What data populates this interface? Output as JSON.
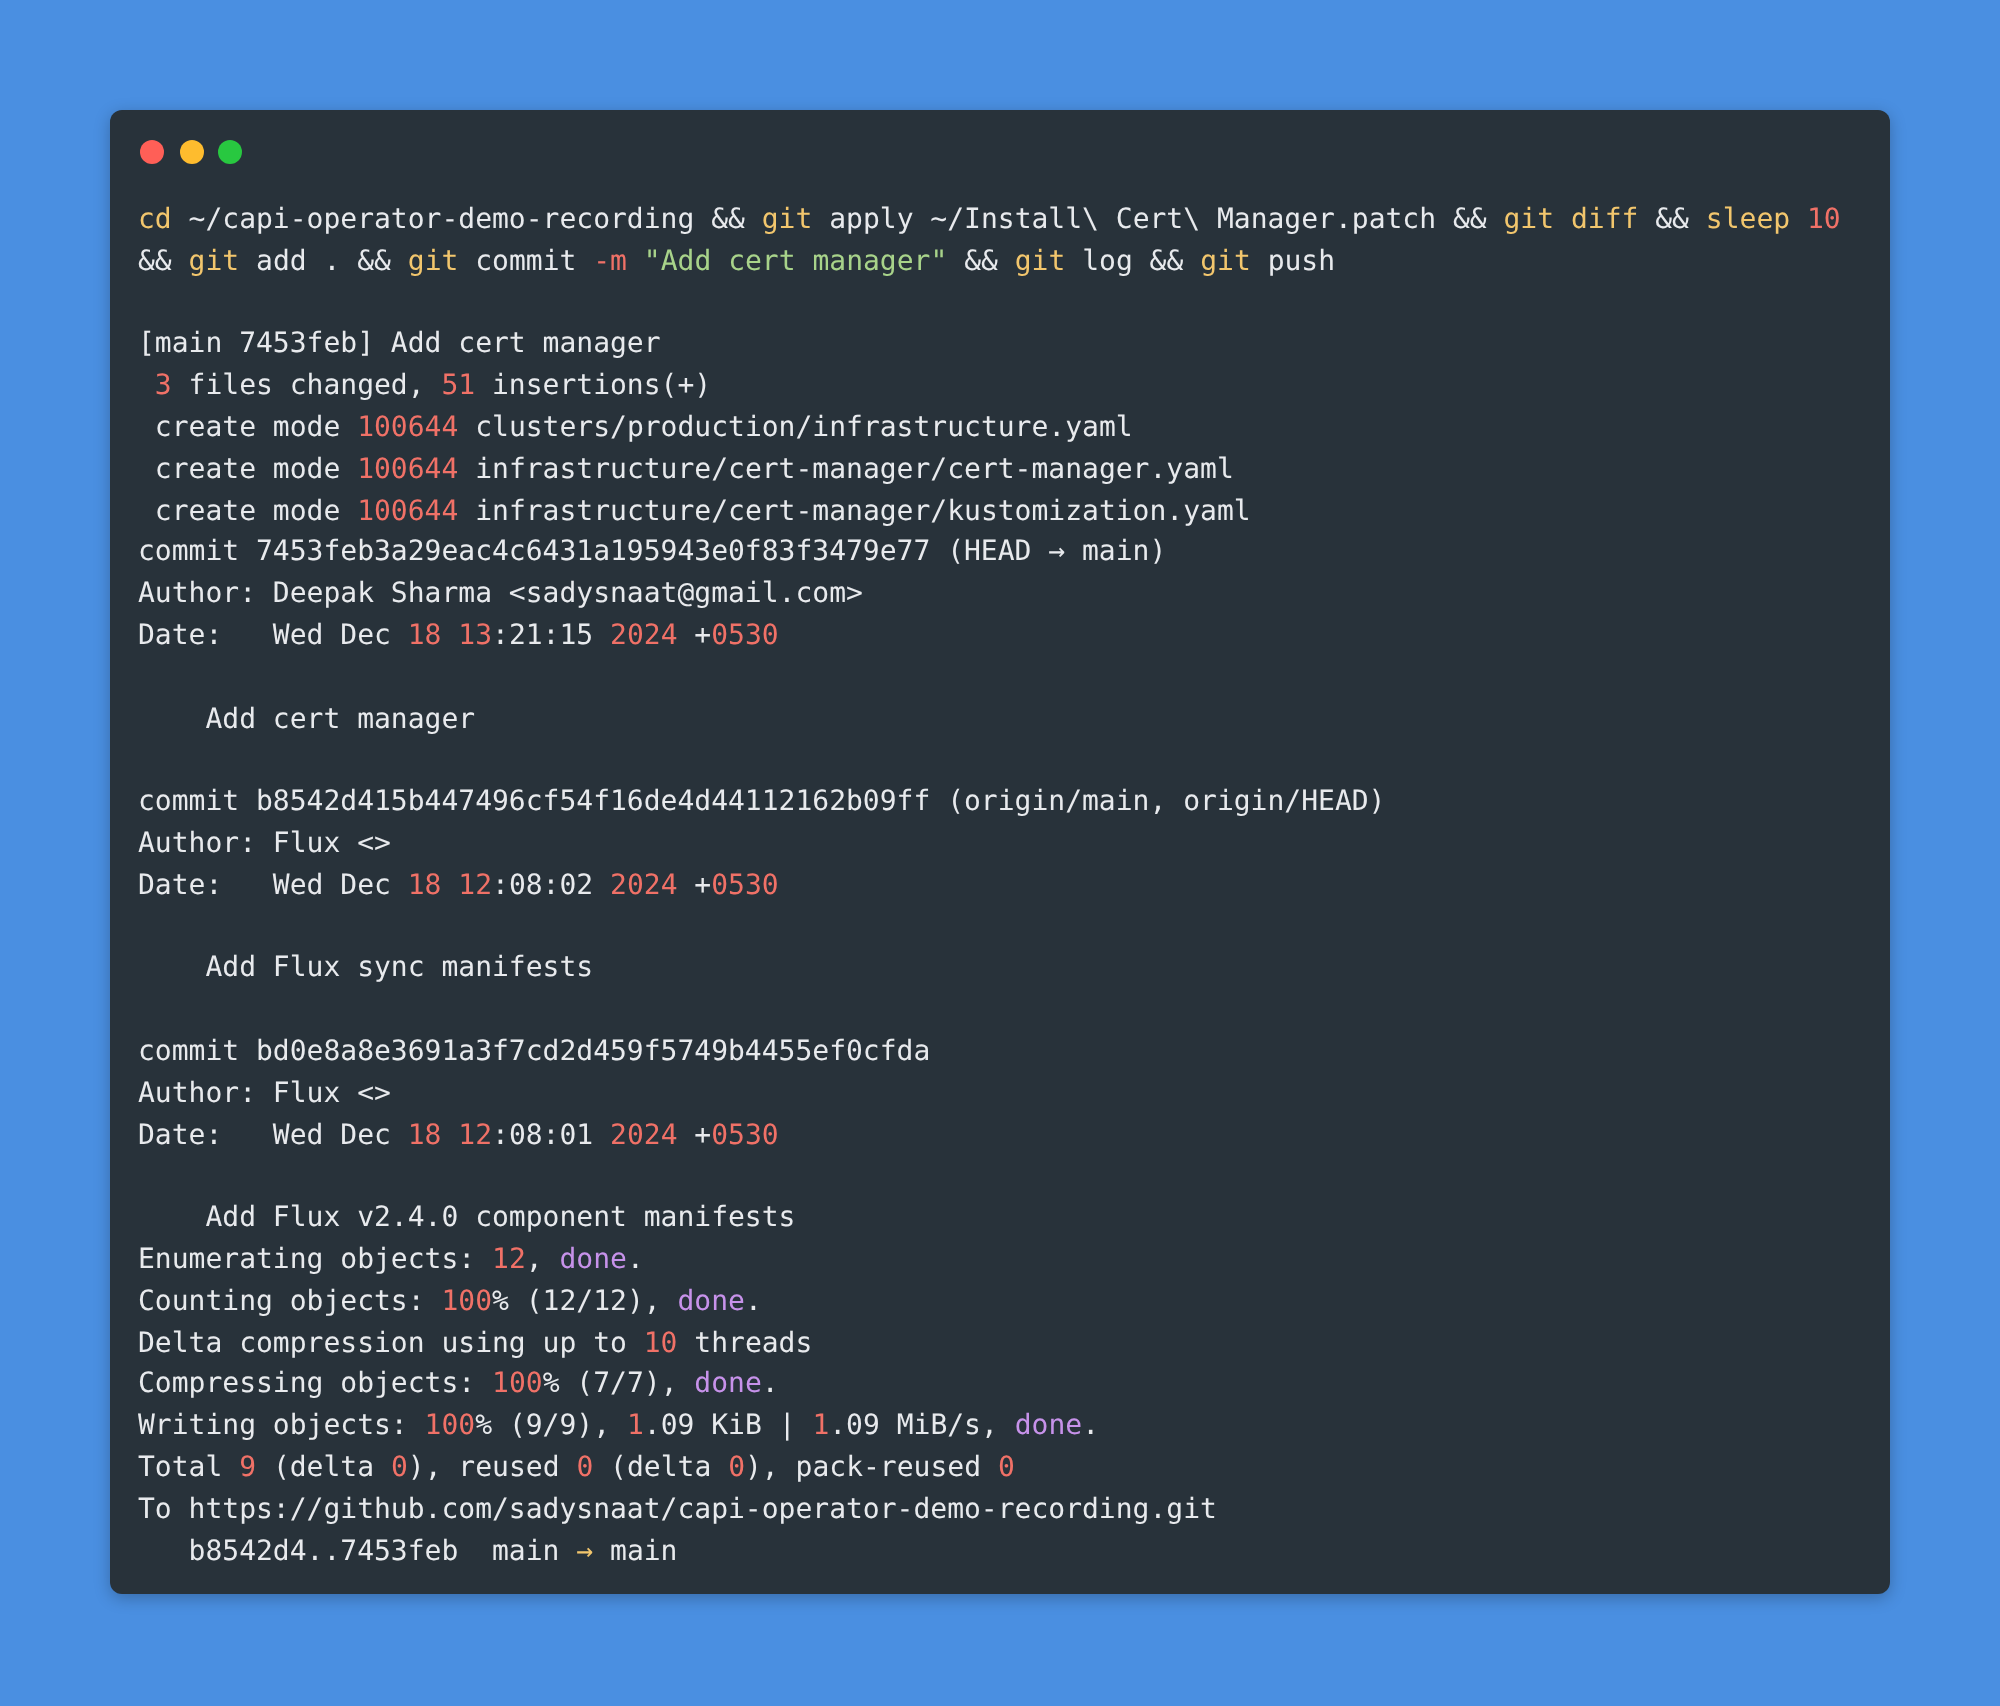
{
  "terminal": {
    "lines": [
      {
        "kind": "text",
        "segments": [
          {
            "text": "cd",
            "kind": "keyword"
          },
          {
            "text": " ~/capi-operator-demo-recording && ",
            "kind": "plain"
          },
          {
            "text": "git",
            "kind": "keyword"
          },
          {
            "text": " apply ~/Install\\ Cert\\ Manager.patch && ",
            "kind": "plain"
          },
          {
            "text": "git diff",
            "kind": "keyword"
          },
          {
            "text": " && ",
            "kind": "plain"
          },
          {
            "text": "sleep",
            "kind": "keyword"
          },
          {
            "text": " 10",
            "kind": "number"
          }
        ]
      },
      {
        "kind": "text",
        "segments": [
          {
            "text": "&& ",
            "kind": "plain"
          },
          {
            "text": "git",
            "kind": "keyword"
          },
          {
            "text": " add . && ",
            "kind": "plain"
          },
          {
            "text": "git",
            "kind": "keyword"
          },
          {
            "text": " commit ",
            "kind": "plain"
          },
          {
            "text": "-m ",
            "kind": "number"
          },
          {
            "text": "\"Add cert manager\"",
            "kind": "string"
          },
          {
            "text": " && ",
            "kind": "plain"
          },
          {
            "text": "git",
            "kind": "keyword"
          },
          {
            "text": " log && ",
            "kind": "plain"
          },
          {
            "text": "git",
            "kind": "keyword"
          },
          {
            "text": " push",
            "kind": "plain"
          }
        ]
      },
      {
        "kind": "blank"
      },
      {
        "kind": "text",
        "segments": [
          {
            "text": "[main 7453feb] Add cert manager",
            "kind": "plain"
          }
        ]
      },
      {
        "kind": "text",
        "segments": [
          {
            "text": " 3",
            "kind": "number"
          },
          {
            "text": " files changed, ",
            "kind": "plain"
          },
          {
            "text": "51",
            "kind": "number"
          },
          {
            "text": " insertions(+)",
            "kind": "plain"
          }
        ]
      },
      {
        "kind": "text",
        "segments": [
          {
            "text": " create mode ",
            "kind": "plain"
          },
          {
            "text": "100644",
            "kind": "number"
          },
          {
            "text": " clusters/production/infrastructure.yaml",
            "kind": "plain"
          }
        ]
      },
      {
        "kind": "text",
        "segments": [
          {
            "text": " create mode ",
            "kind": "plain"
          },
          {
            "text": "100644",
            "kind": "number"
          },
          {
            "text": " infrastructure/cert-manager/cert-manager.yaml",
            "kind": "plain"
          }
        ]
      },
      {
        "kind": "text",
        "segments": [
          {
            "text": " create mode ",
            "kind": "plain"
          },
          {
            "text": "100644",
            "kind": "number"
          },
          {
            "text": " infrastructure/cert-manager/kustomization.yaml",
            "kind": "plain"
          }
        ]
      },
      {
        "kind": "text",
        "segments": [
          {
            "text": "commit 7453feb3a29eac4c6431a195943e0f83f3479e77 (HEAD → main)",
            "kind": "plain"
          }
        ]
      },
      {
        "kind": "text",
        "segments": [
          {
            "text": "Author: Deepak Sharma <sadysnaat@gmail.com>",
            "kind": "plain"
          }
        ]
      },
      {
        "kind": "text",
        "segments": [
          {
            "text": "Date:   Wed Dec ",
            "kind": "plain"
          },
          {
            "text": "18 13",
            "kind": "number"
          },
          {
            "text": ":21:15 ",
            "kind": "plain"
          },
          {
            "text": "2024",
            "kind": "number"
          },
          {
            "text": " +",
            "kind": "plain"
          },
          {
            "text": "0530",
            "kind": "number"
          }
        ]
      },
      {
        "kind": "blank"
      },
      {
        "kind": "text",
        "segments": [
          {
            "text": "    Add cert manager",
            "kind": "plain"
          }
        ]
      },
      {
        "kind": "blank"
      },
      {
        "kind": "text",
        "segments": [
          {
            "text": "commit b8542d415b447496cf54f16de4d44112162b09ff (origin/main, origin/HEAD)",
            "kind": "plain"
          }
        ]
      },
      {
        "kind": "text",
        "segments": [
          {
            "text": "Author: Flux <>",
            "kind": "plain"
          }
        ]
      },
      {
        "kind": "text",
        "segments": [
          {
            "text": "Date:   Wed Dec ",
            "kind": "plain"
          },
          {
            "text": "18 12",
            "kind": "number"
          },
          {
            "text": ":08:02 ",
            "kind": "plain"
          },
          {
            "text": "2024",
            "kind": "number"
          },
          {
            "text": " +",
            "kind": "plain"
          },
          {
            "text": "0530",
            "kind": "number"
          }
        ]
      },
      {
        "kind": "blank"
      },
      {
        "kind": "text",
        "segments": [
          {
            "text": "    Add Flux sync manifests",
            "kind": "plain"
          }
        ]
      },
      {
        "kind": "blank"
      },
      {
        "kind": "text",
        "segments": [
          {
            "text": "commit bd0e8a8e3691a3f7cd2d459f5749b4455ef0cfda",
            "kind": "plain"
          }
        ]
      },
      {
        "kind": "text",
        "segments": [
          {
            "text": "Author: Flux <>",
            "kind": "plain"
          }
        ]
      },
      {
        "kind": "text",
        "segments": [
          {
            "text": "Date:   Wed Dec ",
            "kind": "plain"
          },
          {
            "text": "18 12",
            "kind": "number"
          },
          {
            "text": ":08:01 ",
            "kind": "plain"
          },
          {
            "text": "2024",
            "kind": "number"
          },
          {
            "text": " +",
            "kind": "plain"
          },
          {
            "text": "0530",
            "kind": "number"
          }
        ]
      },
      {
        "kind": "blank"
      },
      {
        "kind": "text",
        "segments": [
          {
            "text": "    Add Flux v2.4.0 component manifests",
            "kind": "plain"
          }
        ]
      },
      {
        "kind": "text",
        "segments": [
          {
            "text": "Enumerating objects: ",
            "kind": "plain"
          },
          {
            "text": "12",
            "kind": "number"
          },
          {
            "text": ", ",
            "kind": "plain"
          },
          {
            "text": "done",
            "kind": "done"
          },
          {
            "text": ".",
            "kind": "plain"
          }
        ]
      },
      {
        "kind": "text",
        "segments": [
          {
            "text": "Counting objects: ",
            "kind": "plain"
          },
          {
            "text": "100",
            "kind": "number"
          },
          {
            "text": "% (12/12), ",
            "kind": "plain"
          },
          {
            "text": "done",
            "kind": "done"
          },
          {
            "text": ".",
            "kind": "plain"
          }
        ]
      },
      {
        "kind": "text",
        "segments": [
          {
            "text": "Delta compression using up to ",
            "kind": "plain"
          },
          {
            "text": "10",
            "kind": "number"
          },
          {
            "text": " threads",
            "kind": "plain"
          }
        ]
      },
      {
        "kind": "text",
        "segments": [
          {
            "text": "Compressing objects: ",
            "kind": "plain"
          },
          {
            "text": "100",
            "kind": "number"
          },
          {
            "text": "% (7/7), ",
            "kind": "plain"
          },
          {
            "text": "done",
            "kind": "done"
          },
          {
            "text": ".",
            "kind": "plain"
          }
        ]
      },
      {
        "kind": "text",
        "segments": [
          {
            "text": "Writing objects: ",
            "kind": "plain"
          },
          {
            "text": "100",
            "kind": "number"
          },
          {
            "text": "% (9/9), ",
            "kind": "plain"
          },
          {
            "text": "1",
            "kind": "number"
          },
          {
            "text": ".09 KiB | ",
            "kind": "plain"
          },
          {
            "text": "1",
            "kind": "number"
          },
          {
            "text": ".09 MiB/s, ",
            "kind": "plain"
          },
          {
            "text": "done",
            "kind": "done"
          },
          {
            "text": ".",
            "kind": "plain"
          }
        ]
      },
      {
        "kind": "text",
        "segments": [
          {
            "text": "Total ",
            "kind": "plain"
          },
          {
            "text": "9",
            "kind": "number"
          },
          {
            "text": " (delta ",
            "kind": "plain"
          },
          {
            "text": "0",
            "kind": "number"
          },
          {
            "text": "), reused ",
            "kind": "plain"
          },
          {
            "text": "0",
            "kind": "number"
          },
          {
            "text": " (delta ",
            "kind": "plain"
          },
          {
            "text": "0",
            "kind": "number"
          },
          {
            "text": "), pack-reused ",
            "kind": "plain"
          },
          {
            "text": "0",
            "kind": "number"
          }
        ]
      },
      {
        "kind": "text",
        "segments": [
          {
            "text": "To https://github.com/sadysnaat/capi-operator-demo-recording.git",
            "kind": "plain"
          }
        ]
      },
      {
        "kind": "text",
        "segments": [
          {
            "text": "   b8542d4..7453feb  main ",
            "kind": "plain"
          },
          {
            "text": "→",
            "kind": "keyword"
          },
          {
            "text": " main",
            "kind": "plain"
          }
        ]
      }
    ]
  }
}
